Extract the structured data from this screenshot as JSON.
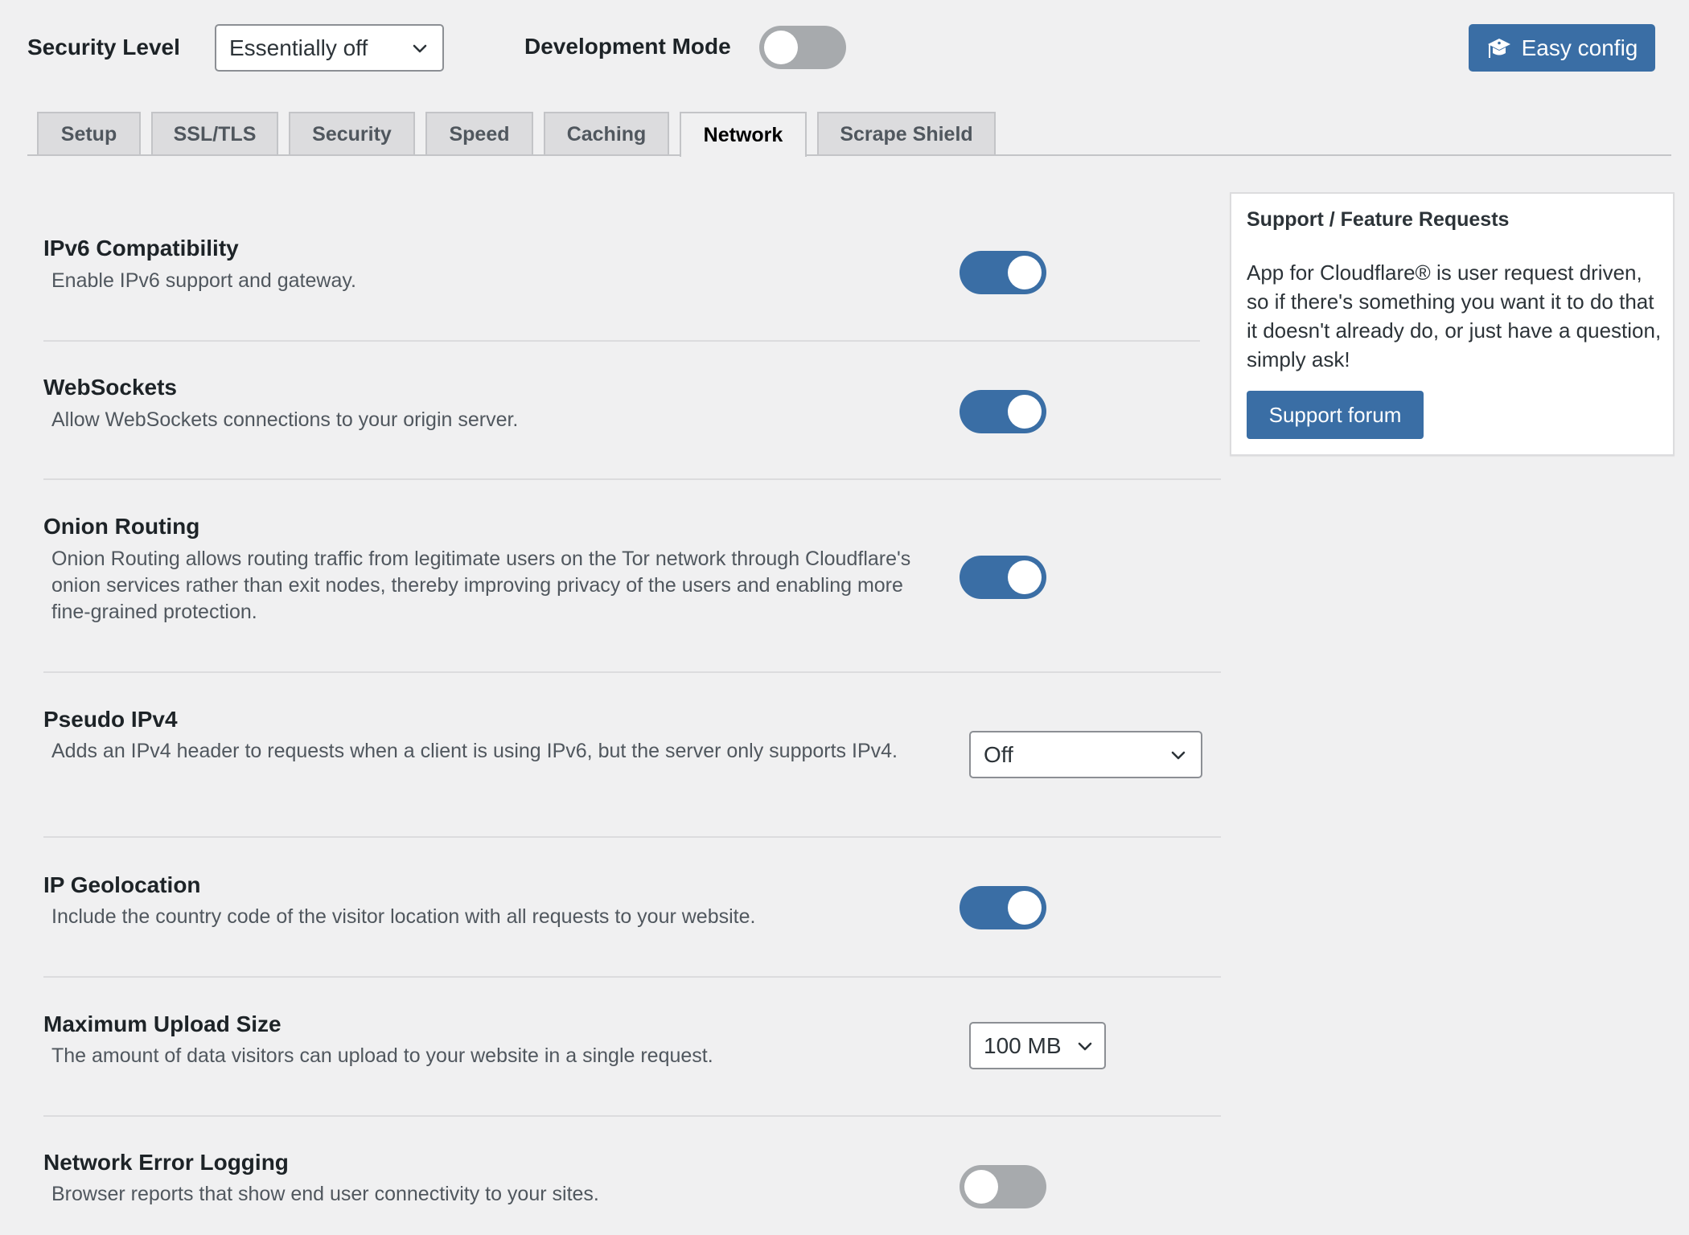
{
  "header": {
    "security_level_label": "Security Level",
    "security_level_value": "Essentially off",
    "development_mode_label": "Development Mode",
    "development_mode_on": false,
    "easy_config_label": "Easy config",
    "easy_config_icon": "graduation-cap-icon"
  },
  "tabs": [
    {
      "label": "Setup",
      "active": false
    },
    {
      "label": "SSL/TLS",
      "active": false
    },
    {
      "label": "Security",
      "active": false
    },
    {
      "label": "Speed",
      "active": false
    },
    {
      "label": "Caching",
      "active": false
    },
    {
      "label": "Network",
      "active": true
    },
    {
      "label": "Scrape Shield",
      "active": false
    }
  ],
  "settings": [
    {
      "title": "IPv6 Compatibility",
      "description": "Enable IPv6 support and gateway.",
      "control": "toggle",
      "on": true
    },
    {
      "title": "WebSockets",
      "description": "Allow WebSockets connections to your origin server.",
      "control": "toggle",
      "on": true
    },
    {
      "title": "Onion Routing",
      "description": "Onion Routing allows routing traffic from legitimate users on the Tor network through Cloudflare's onion services rather than exit nodes, thereby improving privacy of the users and enabling more fine-grained protection.",
      "control": "toggle",
      "on": true
    },
    {
      "title": "Pseudo IPv4",
      "description": "Adds an IPv4 header to requests when a client is using IPv6, but the server only supports IPv4.",
      "control": "select",
      "value": "Off"
    },
    {
      "title": "IP Geolocation",
      "description": "Include the country code of the visitor location with all requests to your website.",
      "control": "toggle",
      "on": true
    },
    {
      "title": "Maximum Upload Size",
      "description": "The amount of data visitors can upload to your website in a single request.",
      "control": "select",
      "value": "100 MB"
    },
    {
      "title": "Network Error Logging",
      "description": "Browser reports that show end user connectivity to your sites.",
      "control": "toggle",
      "on": false
    }
  ],
  "support": {
    "title": "Support / Feature Requests",
    "body": "App for Cloudflare® is user request driven, so if there's something you want it to do that it doesn't already do, or just have a question, simply ask!",
    "button_label": "Support forum"
  },
  "colors": {
    "accent": "#3a6ea5",
    "toggle_off": "#a7aaad",
    "background": "#f0f0f1"
  }
}
